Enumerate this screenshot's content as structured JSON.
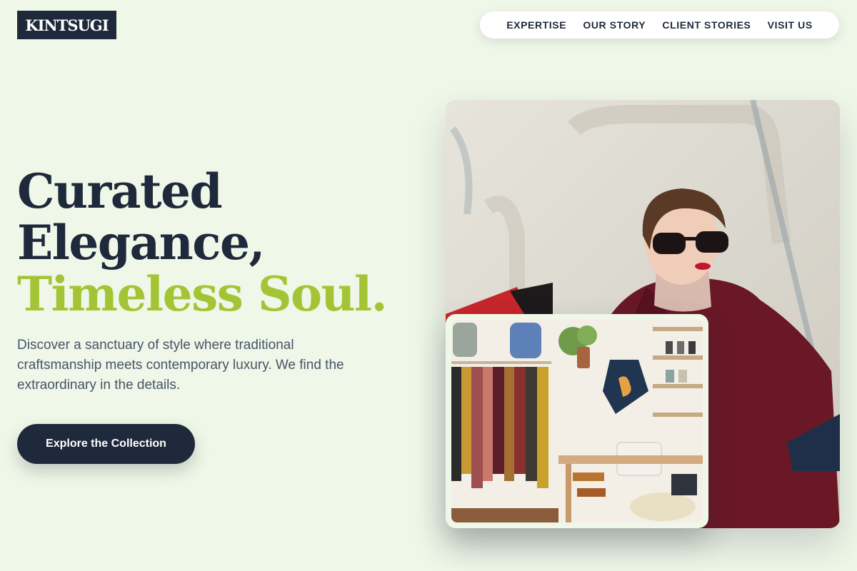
{
  "brand": {
    "logo_text": "KINTSUGI"
  },
  "nav": {
    "items": [
      "EXPERTISE",
      "OUR STORY",
      "CLIENT STORIES",
      "VISIT US"
    ]
  },
  "hero": {
    "headline_line1": "Curated",
    "headline_line2": "Elegance,",
    "headline_line3": "Timeless Soul.",
    "subtext": "Discover a sanctuary of style where traditional craftsmanship meets contemporary luxury. We find the extraordinary in the details.",
    "cta_label": "Explore the Collection"
  },
  "colors": {
    "background": "#eff7e8",
    "navy": "#1e293b",
    "accent_green": "#a3c535",
    "body_text": "#475569"
  }
}
